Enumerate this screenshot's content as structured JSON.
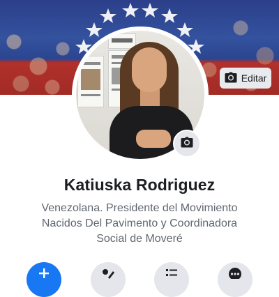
{
  "profile": {
    "name": "Katiuska Rodriguez",
    "bio_lines": [
      "Venezolana. Presidente del Movimiento",
      "Nacidos Del Pavimento y Coordinadora",
      "Social de Moveré"
    ]
  },
  "cover": {
    "edit_label": "Editar",
    "colors": {
      "flag_blue": "#2b3f8a",
      "flag_red": "#b1302b",
      "star": "#ffffff"
    }
  },
  "actions": [
    {
      "icon": "add-story-icon",
      "color": "#1877f2"
    },
    {
      "icon": "edit-profile-icon",
      "color": "#e4e6eb"
    },
    {
      "icon": "activity-log-icon",
      "color": "#e4e6eb"
    },
    {
      "icon": "more-icon",
      "color": "#e4e6eb"
    }
  ]
}
